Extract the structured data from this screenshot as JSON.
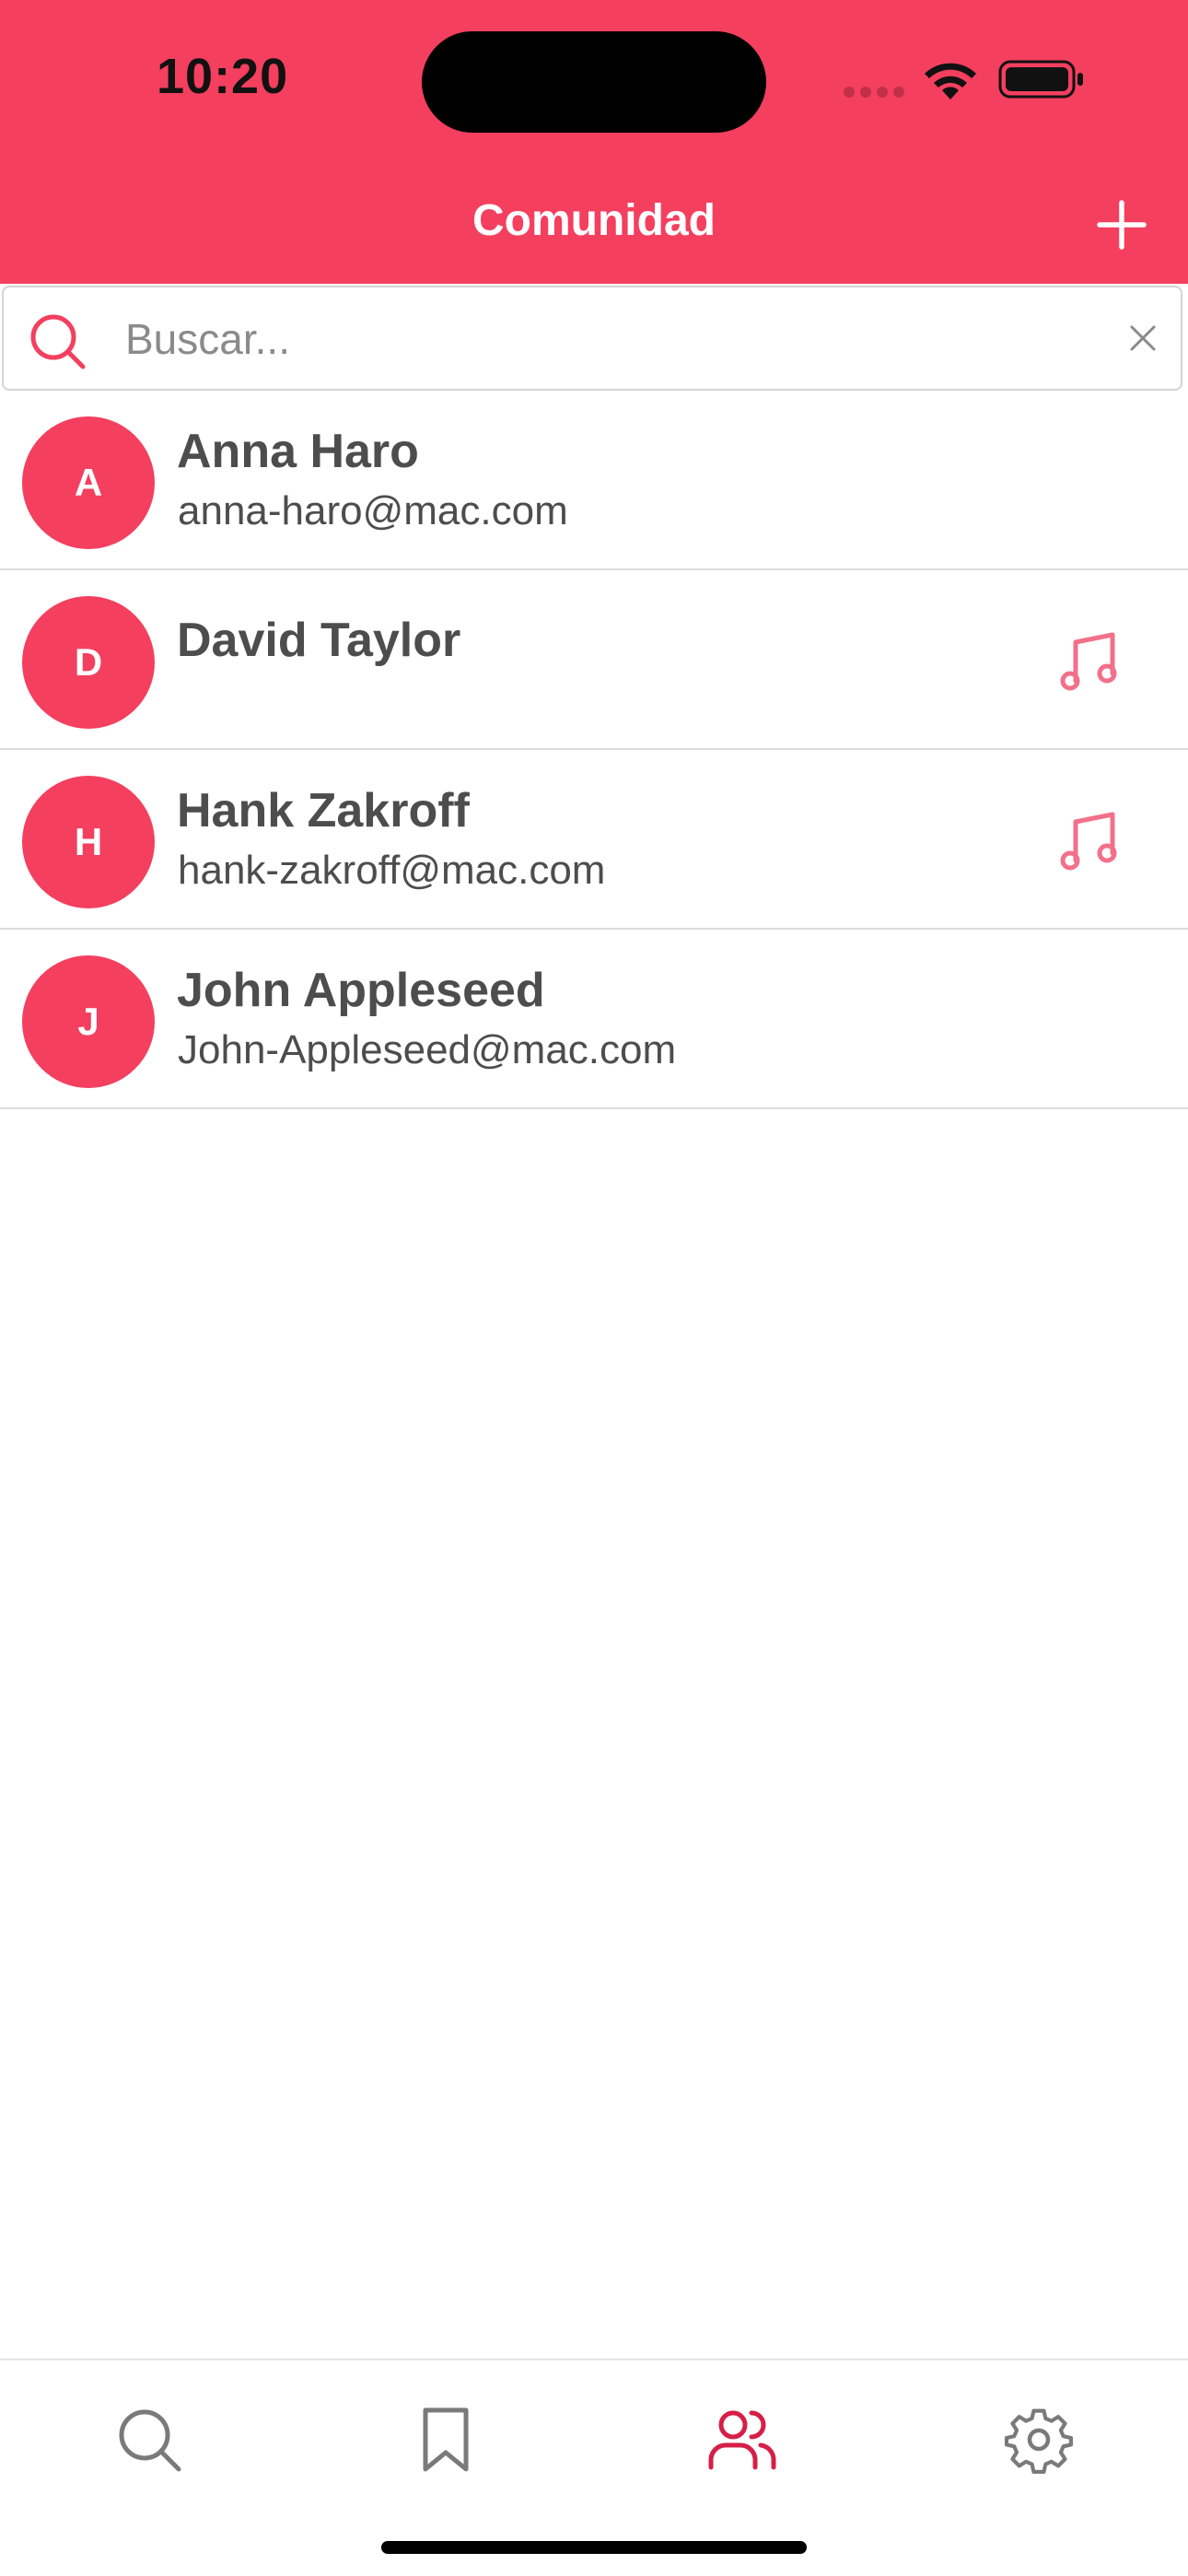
{
  "status_bar": {
    "time": "10:20"
  },
  "header": {
    "title": "Comunidad",
    "add_icon": "plus-icon"
  },
  "search": {
    "value": "",
    "placeholder": "Buscar...",
    "icon": "search-icon",
    "clear_icon": "close-icon"
  },
  "contacts": [
    {
      "initial": "A",
      "name": "Anna Haro",
      "email": "anna-haro@mac.com",
      "music": false
    },
    {
      "initial": "D",
      "name": "David Taylor",
      "email": "",
      "music": true
    },
    {
      "initial": "H",
      "name": "Hank Zakroff",
      "email": "hank-zakroff@mac.com",
      "music": true
    },
    {
      "initial": "J",
      "name": "John Appleseed",
      "email": "John-Appleseed@mac.com",
      "music": false
    }
  ],
  "tab_bar": {
    "tabs": [
      {
        "icon": "search-icon",
        "active": false
      },
      {
        "icon": "bookmark-icon",
        "active": false
      },
      {
        "icon": "people-icon",
        "active": true
      },
      {
        "icon": "gear-icon",
        "active": false
      }
    ]
  },
  "colors": {
    "accent": "#f43f5f",
    "text": "#4d4d4d",
    "tab_inactive": "#7a7a7a",
    "tab_active": "#d61f48"
  }
}
